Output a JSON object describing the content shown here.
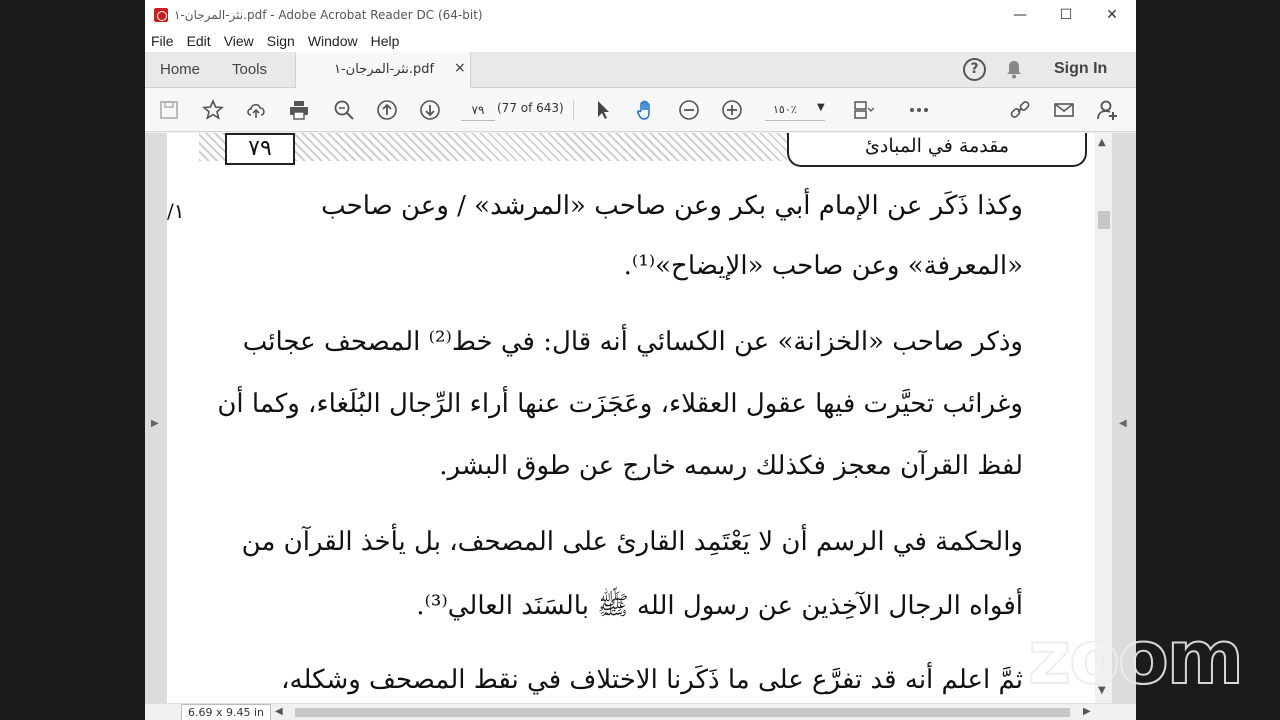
{
  "window": {
    "title": "نثر-المرجان-١.pdf - Adobe Acrobat Reader DC (64-bit)",
    "minimize": "—",
    "maximize": "☐",
    "close": "✕"
  },
  "menu": [
    "File",
    "Edit",
    "View",
    "Sign",
    "Window",
    "Help"
  ],
  "tabs": {
    "home": "Home",
    "tools": "Tools",
    "document": "نثر-المرجان-١.pdf",
    "close": "×",
    "help": "?",
    "sign_in": "Sign In"
  },
  "toolbar": {
    "page_number": "٧٩",
    "page_of": "(77 of 643)",
    "zoom": "١٥٠٪",
    "icons": [
      "save-icon",
      "star-icon",
      "upload-icon",
      "print-icon",
      "zoom-search-icon",
      "page-up-icon",
      "page-down-icon",
      "select-cursor-icon",
      "hand-icon",
      "zoom-out-icon",
      "zoom-in-icon",
      "page-display-icon",
      "more-icon",
      "share-link-icon",
      "mail-icon",
      "add-user-icon"
    ]
  },
  "page": {
    "header_number": "٧٩",
    "header_title": "مقدمة في المبادئ",
    "margin_mark": "١/",
    "lines": [
      "وكذا ذَكَر عن الإمام أبي بكر وعن صاحب «المرشد» / وعن صاحب",
      "«المعرفة» وعن صاحب «الإيضاح»⁽¹⁾.",
      "وذكر صاحب «الخزانة» عن الكسائي أنه قال: في خط⁽²⁾ المصحف عجائب",
      "وغرائب تحيَّرت فيها عقول العقلاء، وعَجَزَت عنها أراء الرِّجال البُلَغاء، وكما أن",
      "لفظ القرآن معجز فكذلك رسمه خارج عن طوق البشر.",
      "والحكمة في الرسم أن لا يَعْتَمِد القارئ على المصحف، بل يأخذ القرآن من",
      "أفواه الرجال الآخِذين عن رسول الله ﷺ بالسَنَد العالي⁽³⁾.",
      "ثمَّ اعلم أنه قد تفرَّع على ما ذَكَرنا الاختلاف في نقط المصحف وشكله،"
    ]
  },
  "status": {
    "page_size": "6.69 x 9.45 in"
  },
  "watermark": "zoom"
}
